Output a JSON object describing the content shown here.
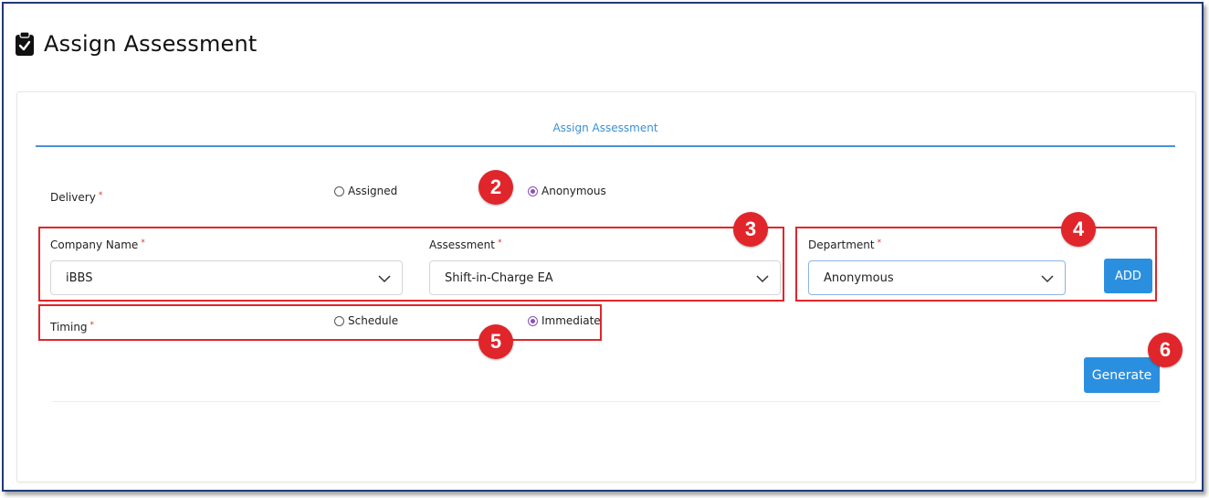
{
  "header": {
    "title": "Assign Assessment",
    "icon": "clipboard-check-icon"
  },
  "tab": {
    "label": "Assign Assessment"
  },
  "delivery": {
    "label": "Delivery",
    "required_mark": "*",
    "options": [
      {
        "label": "Assigned",
        "checked": false
      },
      {
        "label": "Anonymous",
        "checked": true
      }
    ]
  },
  "company": {
    "label": "Company Name",
    "required_mark": "*",
    "value": "iBBS"
  },
  "assessment": {
    "label": "Assessment",
    "required_mark": "*",
    "value": "Shift-in-Charge EA"
  },
  "department": {
    "label": "Department",
    "required_mark": "*",
    "value": "Anonymous",
    "add_label": "ADD"
  },
  "timing": {
    "label": "Timing",
    "required_mark": "*",
    "options": [
      {
        "label": "Schedule",
        "checked": false
      },
      {
        "label": "Immediate",
        "checked": true
      }
    ]
  },
  "actions": {
    "generate_label": "Generate"
  },
  "callouts": {
    "b2": "2",
    "b3": "3",
    "b4": "4",
    "b5": "5",
    "b6": "6"
  },
  "colors": {
    "accent": "#2b8fe0",
    "radio_checked": "#8a4fb8",
    "callout": "#e0262b",
    "required": "#e03030"
  }
}
